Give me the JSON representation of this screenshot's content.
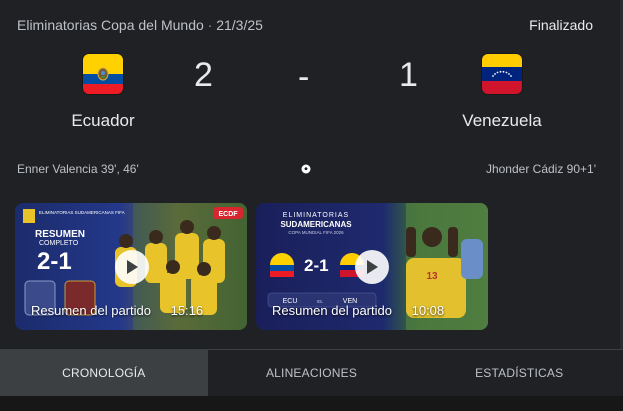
{
  "header": {
    "competition": "Eliminatorias Copa del Mundo",
    "separator": "·",
    "date": "21/3/25",
    "status": "Finalizado"
  },
  "match": {
    "home": {
      "name": "Ecuador",
      "score": "2",
      "flag_icon": "ecuador-flag-icon",
      "scorers": "Enner Valencia 39', 46'"
    },
    "away": {
      "name": "Venezuela",
      "score": "1",
      "flag_icon": "venezuela-flag-icon",
      "scorers": "Jhonder Cádiz 90+1'"
    },
    "score_separator": "-"
  },
  "videos": [
    {
      "caption": "Resumen del partido",
      "duration": "15:16",
      "thumb": {
        "badge": "ECDF",
        "line1": "RESUMEN",
        "line2": "COMPLETO",
        "score": "2-1",
        "logo_text": "ELIMINATORIAS SUDAMERICANAS FIFA"
      }
    },
    {
      "caption": "Resumen del partido",
      "duration": "10:08",
      "thumb": {
        "title1": "ELIMINATORIAS",
        "title2": "SUDAMERICANAS",
        "subtitle": "COPA MUNDIAL FIFA 2026",
        "score": "2-1",
        "home_abbr": "ECU",
        "vs": "vs.",
        "away_abbr": "VEN",
        "jersey_number": "13"
      }
    }
  ],
  "tabs": [
    {
      "label": "CRONOLOGÍA",
      "active": true
    },
    {
      "label": "ALINEACIONES",
      "active": false
    },
    {
      "label": "ESTADÍSTICAS",
      "active": false
    }
  ],
  "colors": {
    "background": "#202124",
    "text": "#e8eaed",
    "secondary_text": "#bdc1c6",
    "active_tab": "#3c4043",
    "ecuador_yellow": "#FFD100",
    "ecuador_blue": "#034EA2",
    "ecuador_red": "#ED1C24",
    "venezuela_yellow": "#FFCC00",
    "venezuela_blue": "#00247D",
    "venezuela_red": "#CF142B"
  }
}
